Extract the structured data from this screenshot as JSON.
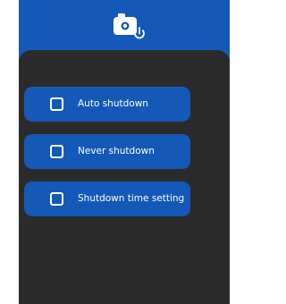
{
  "header": {
    "icon": "camera-power-icon"
  },
  "options": [
    {
      "label": "Auto shutdown",
      "checked": false
    },
    {
      "label": "Never shutdown",
      "checked": false
    },
    {
      "label": "Shutdown time setting",
      "checked": false
    }
  ],
  "colors": {
    "header_bg": "#1459b8",
    "panel_bg": "#2b2b2b",
    "option_bg": "#1459b8",
    "text": "#ffffff"
  }
}
